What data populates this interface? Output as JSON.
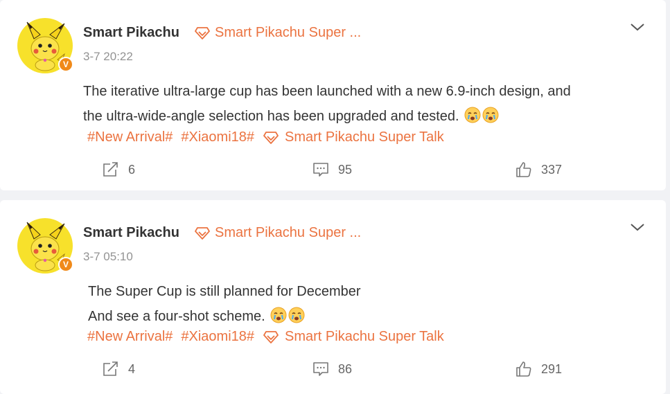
{
  "posts": [
    {
      "author": "Smart Pikachu",
      "super_talk": "Smart Pikachu Super ...",
      "timestamp": "3-7 20:22",
      "lines": [
        " The iterative ultra-large cup has been launched with a new 6.9-inch design, and",
        "the ultra-wide-angle selection has been upgraded and tested."
      ],
      "emoji": "crying-face",
      "tags": [
        "#New Arrival#",
        "#Xiaomi18#",
        "Smart Pikachu Super Talk"
      ],
      "reposts": "6",
      "comments": "95",
      "likes": "337"
    },
    {
      "author": "Smart Pikachu",
      "super_talk": "Smart Pikachu Super ...",
      "timestamp": "3-7 05:10",
      "lines": [
        "The Super Cup is still planned for December",
        "And see a four-shot scheme."
      ],
      "emoji": "crying-face",
      "tags": [
        "#New Arrival#",
        "#Xiaomi18#",
        "Smart Pikachu Super Talk"
      ],
      "reposts": "4",
      "comments": "86",
      "likes": "291"
    }
  ],
  "colors": {
    "accent": "#eb7340",
    "verified_badge": "#f08a1a",
    "background": "#f1f2f5"
  },
  "icons": {
    "verified": "V",
    "super_talk": "diamond-icon",
    "repost": "repost-icon",
    "comment": "comment-icon",
    "like": "thumbs-up-icon",
    "more": "chevron-down-icon"
  }
}
